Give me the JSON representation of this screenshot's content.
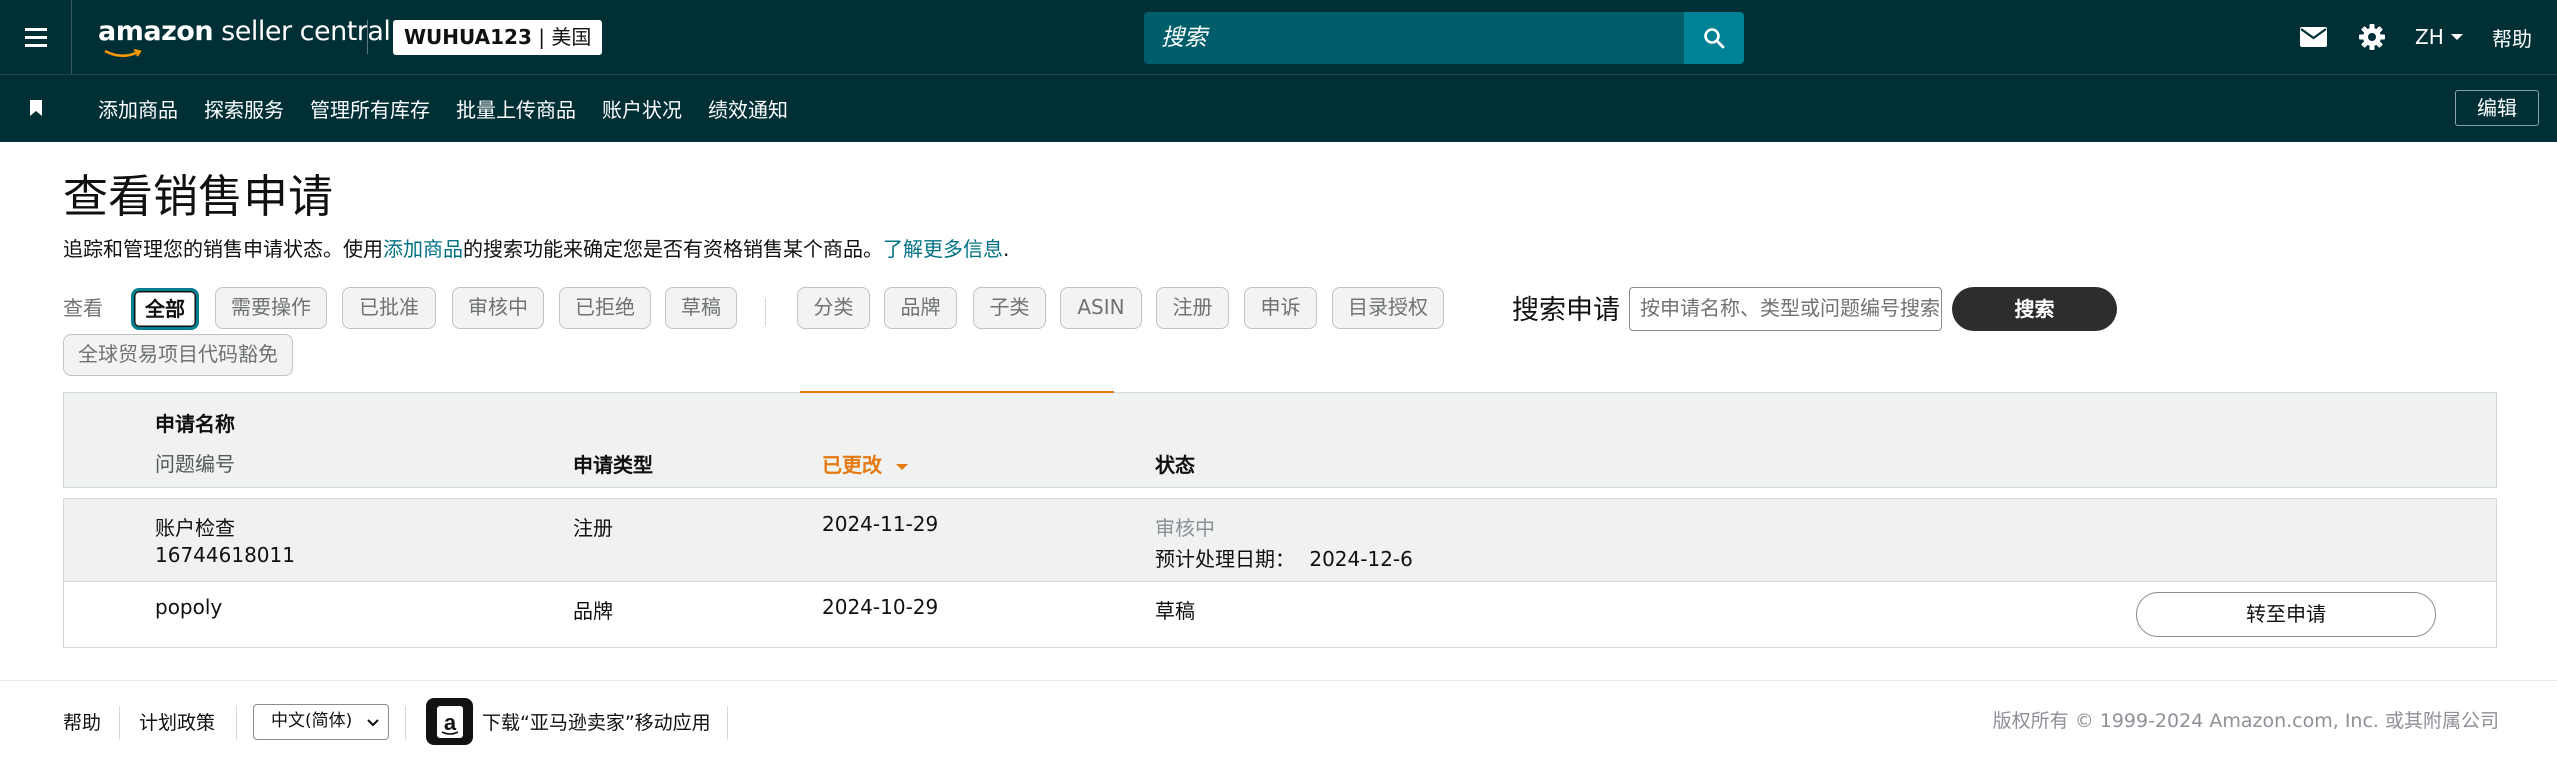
{
  "header": {
    "logo_main": "amazon",
    "logo_sub": " seller central",
    "store_name": "WUHUA123",
    "store_region": " | 美国",
    "search_placeholder": "搜索",
    "language": "ZH",
    "help": "帮助"
  },
  "nav": {
    "items": [
      "添加商品",
      "探索服务",
      "管理所有库存",
      "批量上传商品",
      "账户状况",
      "绩效通知"
    ],
    "edit": "编辑"
  },
  "page": {
    "title": "查看销售申请",
    "desc_prefix": "追踪和管理您的销售申请状态。使用",
    "desc_link": "添加商品",
    "desc_middle": "的搜索功能来确定您是否有资格销售某个商品。",
    "desc_learn_more": "了解更多信息",
    "desc_suffix": "."
  },
  "filters": {
    "view_label": "查看",
    "status_chips": [
      "全部",
      "需要操作",
      "已批准",
      "审核中",
      "已拒绝",
      "草稿"
    ],
    "type_chips": [
      "分类",
      "品牌",
      "子类",
      "ASIN",
      "注册",
      "申诉",
      "目录授权"
    ],
    "extra_chip": "全球贸易项目代码豁免",
    "active": "全部"
  },
  "search_requests": {
    "label": "搜索申请",
    "placeholder": "按申请名称、类型或问题编号搜索",
    "button": "搜索"
  },
  "table": {
    "columns": {
      "name": "申请名称",
      "issue_no": "问题编号",
      "type": "申请类型",
      "changed": "已更改",
      "status": "状态"
    },
    "rows": [
      {
        "name": "账户检查",
        "issue_no": "16744618011",
        "type": "注册",
        "changed": "2024-11-29",
        "status": "审核中",
        "eta_label": "预计处理日期：",
        "eta": "2024-12-6"
      },
      {
        "name": "popoly",
        "type": "品牌",
        "changed": "2024-10-29",
        "status": "草稿",
        "action": "转至申请"
      }
    ]
  },
  "footer": {
    "help": "帮助",
    "policies": "计划政策",
    "language": "中文(简体)",
    "app_download": "下载“亚马逊卖家”移动应用",
    "copyright": "版权所有 © 1999-2024 Amazon.com, Inc. 或其附属公司"
  },
  "colors": {
    "header_bg": "#002f36",
    "search_bg": "#005e6a",
    "search_btn": "#008296",
    "link": "#007185",
    "sort_accent": "#e47911",
    "active_chip_border": "#017e8f"
  },
  "icons": {
    "menu": "hamburger-icon",
    "search": "search-icon",
    "messages": "envelope-icon",
    "settings": "gear-icon",
    "bookmark": "bookmark-icon",
    "sort": "caret-down-icon",
    "app": "amazon-app-icon"
  }
}
